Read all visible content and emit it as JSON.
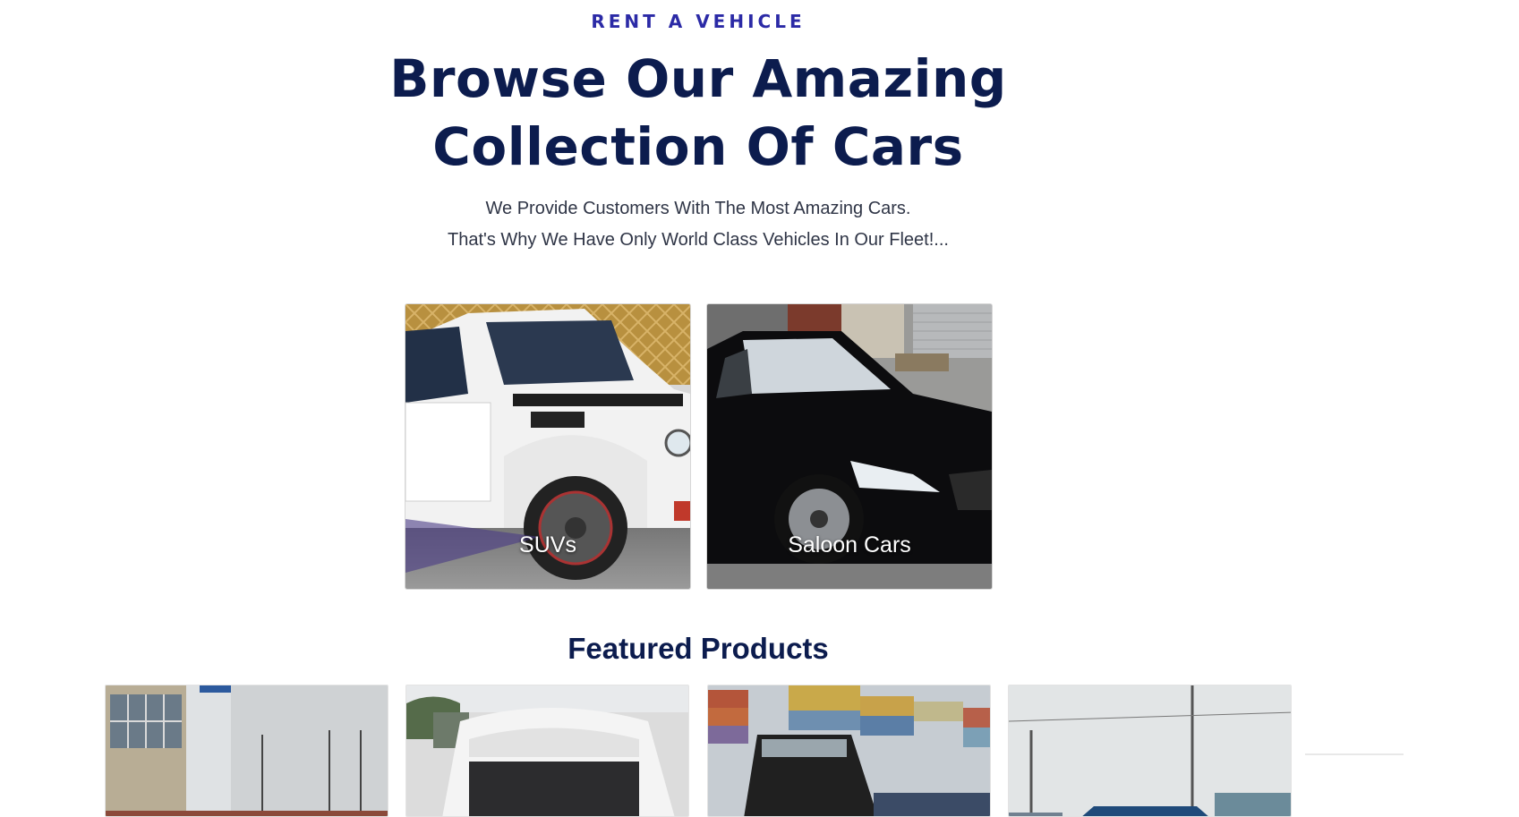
{
  "hero": {
    "eyebrow": "RENT A VEHICLE",
    "headline_line1": "Browse Our Amazing",
    "headline_line2": "Collection Of Cars",
    "subtext_line1": "We Provide Customers With The Most Amazing Cars.",
    "subtext_line2": "That's Why We Have Only World Class Vehicles In Our Fleet!..."
  },
  "categories": [
    {
      "label": "SUVs",
      "image": "white-suv-photo"
    },
    {
      "label": "Saloon Cars",
      "image": "black-sedan-photo"
    }
  ],
  "featured": {
    "title": "Featured Products",
    "items": [
      {
        "image": "dealership-lot-photo"
      },
      {
        "image": "white-van-photo"
      },
      {
        "image": "shipping-containers-suv-photo"
      },
      {
        "image": "blue-vehicle-street-photo"
      }
    ]
  },
  "colors": {
    "eyebrow": "#2b2aa6",
    "headline": "#0c1c4e",
    "body_text": "#2f3546",
    "background": "#ffffff"
  }
}
